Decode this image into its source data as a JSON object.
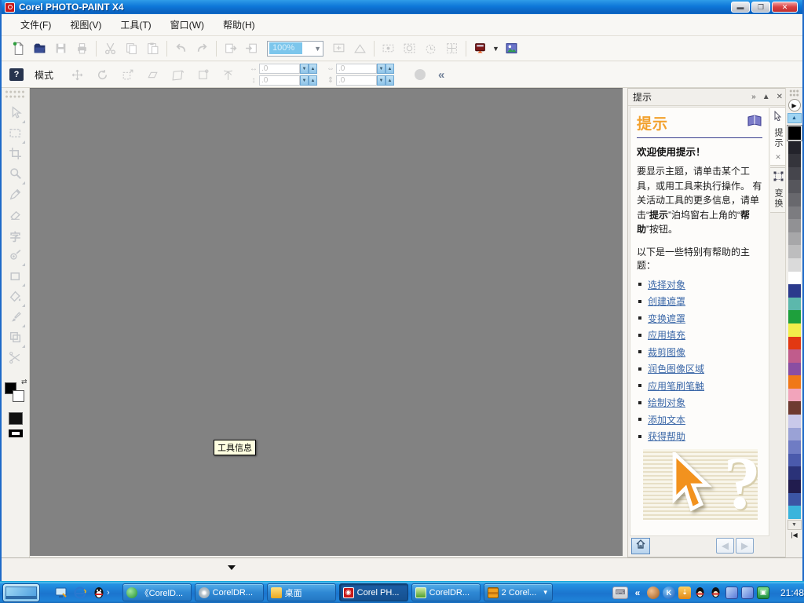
{
  "titlebar": {
    "title": "Corel PHOTO-PAINT X4"
  },
  "menu": {
    "items": [
      {
        "key": "file",
        "label": "文件(F)"
      },
      {
        "key": "view",
        "label": "视图(V)"
      },
      {
        "key": "tools",
        "label": "工具(T)"
      },
      {
        "key": "window",
        "label": "窗口(W)"
      },
      {
        "key": "help",
        "label": "帮助(H)"
      }
    ]
  },
  "toolbar": {
    "zoom_value": "100%",
    "buttons": [
      {
        "icon": "new-page",
        "name": "new-button",
        "enabled": true
      },
      {
        "icon": "open-folder",
        "name": "open-button",
        "enabled": true
      },
      {
        "icon": "save-floppy",
        "name": "save-button",
        "enabled": false
      },
      {
        "icon": "printer",
        "name": "print-button",
        "enabled": false
      },
      {
        "sep": true
      },
      {
        "icon": "cut-scissors",
        "name": "cut-button",
        "enabled": false
      },
      {
        "icon": "copy-pages",
        "name": "copy-button",
        "enabled": false
      },
      {
        "icon": "paste-clipboard",
        "name": "paste-button",
        "enabled": false
      },
      {
        "sep": true
      },
      {
        "icon": "undo-arrow",
        "name": "undo-button",
        "enabled": false
      },
      {
        "icon": "redo-arrow",
        "name": "redo-button",
        "enabled": false
      },
      {
        "sep": true
      },
      {
        "icon": "import-arrow",
        "name": "import-button",
        "enabled": false
      },
      {
        "icon": "export-arrow",
        "name": "export-button",
        "enabled": false
      },
      {
        "combo": true
      },
      {
        "icon": "fullscreen-monitor",
        "name": "fullscreen-preview-button",
        "enabled": false
      },
      {
        "icon": "mask-overlay",
        "name": "mask-overlay-button",
        "enabled": false
      },
      {
        "sep": true
      },
      {
        "icon": "marquee-eye",
        "name": "show-mask-marquee-button",
        "enabled": false
      },
      {
        "icon": "mask-border",
        "name": "mask-border-button",
        "enabled": false
      },
      {
        "icon": "stopwatch",
        "name": "duplicate-button",
        "enabled": false
      },
      {
        "icon": "transparency-grid",
        "name": "transparency-grid-button",
        "enabled": false
      },
      {
        "sep": true
      },
      {
        "icon": "launcher-red",
        "name": "application-launcher-button",
        "enabled": true,
        "caret": true
      },
      {
        "icon": "welcome-screen",
        "name": "welcome-screen-button",
        "enabled": true
      }
    ]
  },
  "property_bar": {
    "mode_label": "模式",
    "help_badge": "?",
    "transform_buttons": [
      {
        "icon": "move-cross",
        "name": "position-button"
      },
      {
        "icon": "rotate-arrow",
        "name": "rotate-button"
      },
      {
        "icon": "scale-box",
        "name": "scale-button"
      },
      {
        "icon": "flip-skew",
        "name": "skew-button"
      },
      {
        "icon": "distort-box",
        "name": "distort-button"
      },
      {
        "icon": "perspective-box",
        "name": "perspective-button"
      },
      {
        "icon": "anchor-point",
        "name": "anchor-point-button"
      }
    ],
    "x_value": ".0",
    "y_value": ".0",
    "w_value": ".0",
    "h_value": ".0"
  },
  "toolbox": {
    "tools": [
      {
        "icon": "pick-cursor",
        "name": "pick-tool",
        "flyout": true
      },
      {
        "icon": "mask-rect",
        "name": "mask-tool",
        "flyout": true
      },
      {
        "icon": "crop",
        "name": "crop-tool",
        "flyout": false
      },
      {
        "icon": "zoom-glass",
        "name": "zoom-tool",
        "flyout": true
      },
      {
        "icon": "eyedropper",
        "name": "eyedropper-tool",
        "flyout": false
      },
      {
        "icon": "eraser",
        "name": "eraser-tool",
        "flyout": false
      },
      {
        "icon": "text-zi",
        "name": "text-tool",
        "flyout": false
      },
      {
        "icon": "touchup-eye",
        "name": "touchup-tool",
        "flyout": true
      },
      {
        "icon": "shape-rect",
        "name": "shape-tool",
        "flyout": true
      },
      {
        "icon": "fill-bucket",
        "name": "fill-tool",
        "flyout": true
      },
      {
        "icon": "paint-brush",
        "name": "paint-tool",
        "flyout": true
      },
      {
        "icon": "object-stack",
        "name": "effect-tool",
        "flyout": true
      },
      {
        "icon": "image-slicer",
        "name": "cutout-tool",
        "flyout": false
      }
    ]
  },
  "canvas": {
    "tooltip": "工具信息"
  },
  "docker": {
    "title": "提示",
    "heading": "提示",
    "welcome": "欢迎使用提示！",
    "body_1": "要显示主题，请单击某个工具，或用工具来执行操作。 有关活动工具的更多信息，请单击“",
    "bold_1": "提示",
    "body_2": "”泊坞窗右上角的“",
    "bold_2": "帮助",
    "body_3": "”按钮。",
    "topics_label": "以下是一些特别有帮助的主题：",
    "links": [
      "选择对象",
      "创建遮罩",
      "变换遮罩",
      "应用填充",
      "裁剪图像",
      "润色图像区域",
      "应用笔刷笔触",
      "绘制对象",
      "添加文本",
      "获得帮助"
    ],
    "tabs": [
      {
        "label": "提示",
        "active": true
      },
      {
        "label": "变换",
        "active": false
      }
    ]
  },
  "palette": {
    "selected_index": 0,
    "colors": [
      "#000000",
      "#23232B",
      "#34343B",
      "#45454C",
      "#56565C",
      "#68686D",
      "#7C7C80",
      "#919194",
      "#A7A7A9",
      "#BDBDBE",
      "#DADADA",
      "#FFFFFF",
      "#2B3A8C",
      "#5CB8AC",
      "#1EA03C",
      "#F2EE4A",
      "#E23812",
      "#C05C8C",
      "#8A4EA2",
      "#F07818",
      "#F2A4BB",
      "#6E3A30",
      "#C9C9EA",
      "#9AA2D6",
      "#6F7CC4",
      "#4A5AAC",
      "#2A3278",
      "#211C4E",
      "#3C55A5",
      "#3AB4DC"
    ]
  },
  "taskbar": {
    "quick_launch": [
      {
        "name": "show-desktop"
      },
      {
        "name": "internet-explorer"
      },
      {
        "name": "qq-messenger"
      }
    ],
    "buttons": [
      {
        "label": "《CorelD...",
        "icon": "green-book",
        "active": false,
        "grouped": false
      },
      {
        "label": "CorelDR...",
        "icon": "disc",
        "active": false,
        "grouped": false
      },
      {
        "label": "桌面",
        "icon": "folder",
        "active": false,
        "grouped": false
      },
      {
        "label": "Corel PH...",
        "icon": "photopaint",
        "active": true,
        "grouped": false
      },
      {
        "label": "CorelDR...",
        "icon": "coreldraw",
        "active": false,
        "grouped": false
      },
      {
        "label": "2 Corel...",
        "icon": "group-orange",
        "active": false,
        "grouped": true
      }
    ],
    "tray": [
      {
        "name": "keyboard-indicator"
      },
      {
        "name": "collapse-chevron"
      },
      {
        "name": "sogou-pinyin"
      },
      {
        "name": "kugoo-music"
      },
      {
        "name": "downloader"
      },
      {
        "name": "qq-contact-1"
      },
      {
        "name": "qq-contact-2"
      },
      {
        "name": "network-status-1"
      },
      {
        "name": "network-status-2"
      },
      {
        "name": "security-box"
      }
    ],
    "clock": "21:48"
  }
}
